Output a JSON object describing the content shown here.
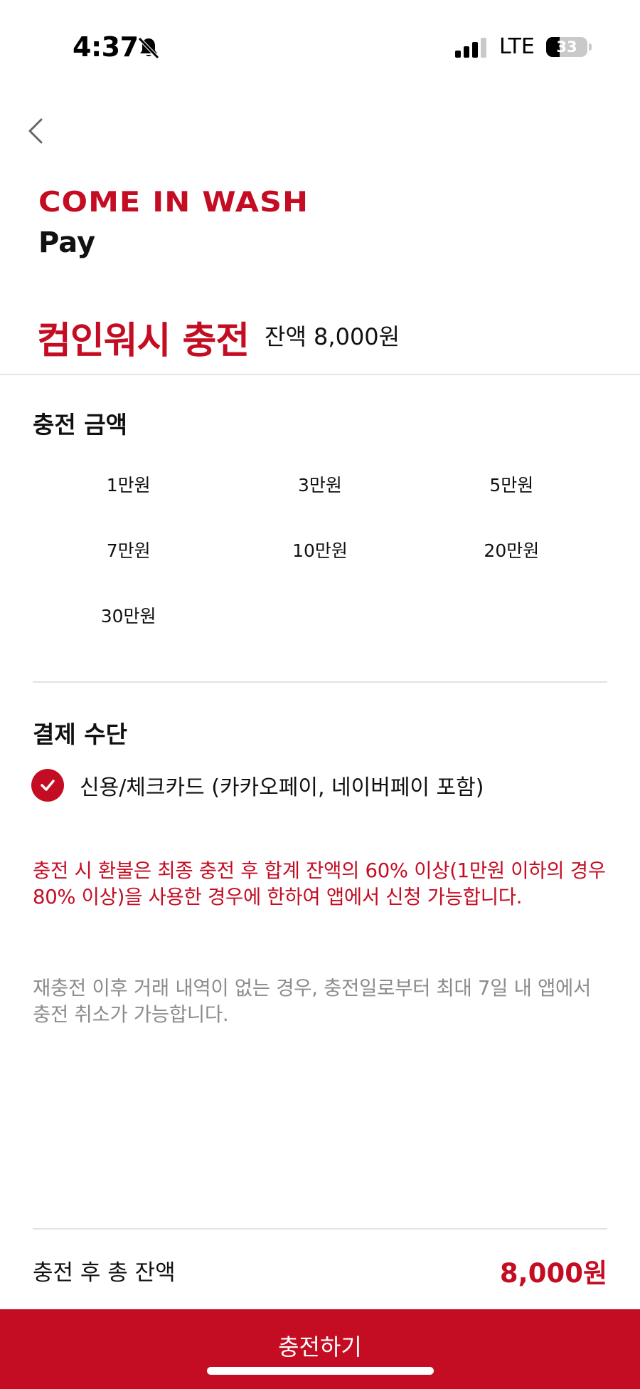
{
  "status_bar": {
    "time": "4:37",
    "network": "LTE",
    "battery": "33",
    "battery_level": 0.33,
    "icons": [
      "bell-slash-icon",
      "signal-icon",
      "battery-icon"
    ]
  },
  "header": {
    "back_icon": "chevron-left-icon",
    "brand_logo": "COME IN WASH",
    "brand_sub": "Pay"
  },
  "title": {
    "main": "컴인워시 충전",
    "balance": "잔액 8,000원"
  },
  "amount_section": {
    "title": "충전 금액",
    "options": [
      "1만원",
      "3만원",
      "5만원",
      "7만원",
      "10만원",
      "20만원",
      "30만원"
    ]
  },
  "payment_section": {
    "title": "결제 수단",
    "option_label": "신용/체크카드 (카카오페이, 네이버페이 포함)",
    "option_selected": true,
    "check_icon": "check-circle-icon"
  },
  "notices": {
    "refund": "충전 시 환불은 최종 충전 후 합계 잔액의 60% 이상(1만원 이하의 경우 80% 이상)을 사용한 경우에 한하여 앱에서 신청 가능합니다.",
    "cancel": "재충전 이후 거래 내역이 없는 경우, 충전일로부터 최대 7일 내 앱에서 충전 취소가 가능합니다."
  },
  "total": {
    "label": "충전 후 총 잔액",
    "value": "8,000원"
  },
  "charge_button": {
    "label": "충전하기"
  },
  "colors": {
    "accent": "#c40d23",
    "text": "#111111",
    "muted": "#8c8c8c",
    "divider": "#e3e3e3"
  }
}
